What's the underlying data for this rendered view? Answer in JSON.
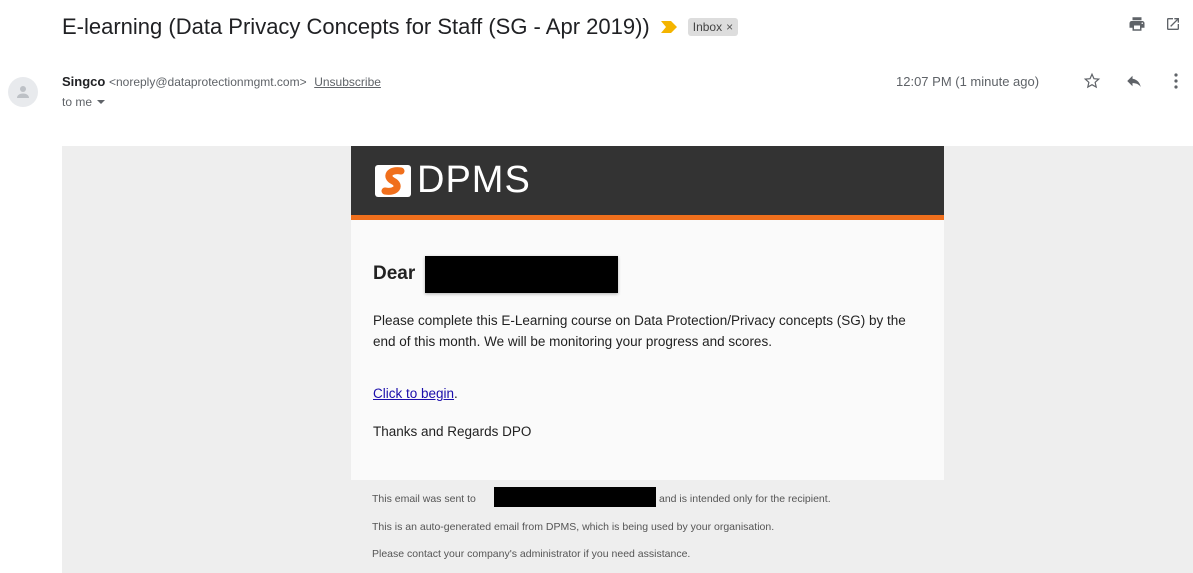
{
  "subject": "E-learning (Data Privacy Concepts for Staff (SG - Apr 2019))",
  "label": "Inbox",
  "label_close": "×",
  "colors": {
    "importance": "#f4b400",
    "accent": "#f06f1c",
    "header": "#333333",
    "link": "#1a0dab"
  },
  "sender": {
    "name": "Singco",
    "email": "<noreply@dataprotectionmgmt.com>",
    "unsubscribe": "Unsubscribe",
    "to": "to me"
  },
  "timestamp": "12:07 PM (1 minute ago)",
  "icons": [
    "print-icon",
    "open-in-new-icon",
    "star-icon",
    "reply-icon",
    "more-vert-icon",
    "avatar-icon",
    "chevron-down-icon"
  ],
  "email": {
    "logo_text": "DPMS",
    "greeting": "Dear",
    "paragraph": "Please complete this E-Learning course on Data Protection/Privacy concepts (SG) by the end of this month. We will be monitoring your progress and scores.",
    "link_text": "Click to begin",
    "link_suffix": ".",
    "signoff": "Thanks and Regards DPO"
  },
  "footer": {
    "line1_prefix": "This email was sent to",
    "line1_suffix": "and is intended only for the recipient.",
    "line2": "This is an auto-generated email from DPMS, which is being used by your organisation.",
    "line3": "Please contact your company's administrator if you need assistance."
  }
}
